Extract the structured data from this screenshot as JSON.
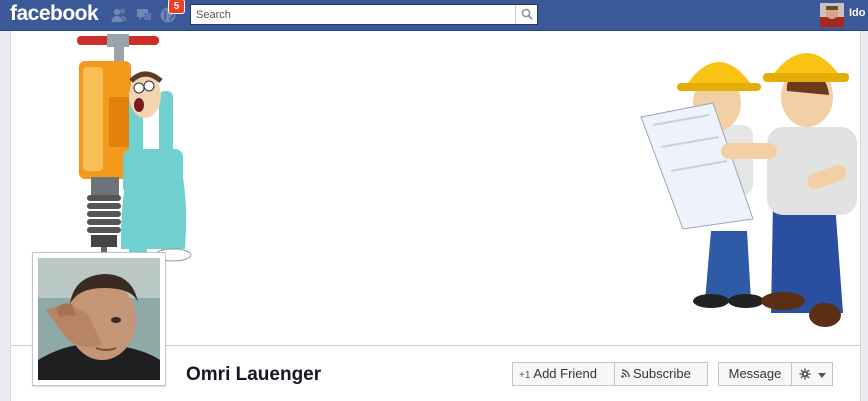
{
  "topbar": {
    "logo": "facebook",
    "jewels": [
      "friends-icon",
      "messages-icon",
      "notifications-icon"
    ],
    "notification_count": "5",
    "search_placeholder": "Search",
    "user_name": "Ido",
    "colors": {
      "bar": "#3b5998",
      "badge": "#f03d25"
    }
  },
  "profile": {
    "name": "Omri Lauenger"
  },
  "actions": {
    "add_friend": "Add Friend",
    "subscribe": "Subscribe",
    "message": "Message"
  }
}
